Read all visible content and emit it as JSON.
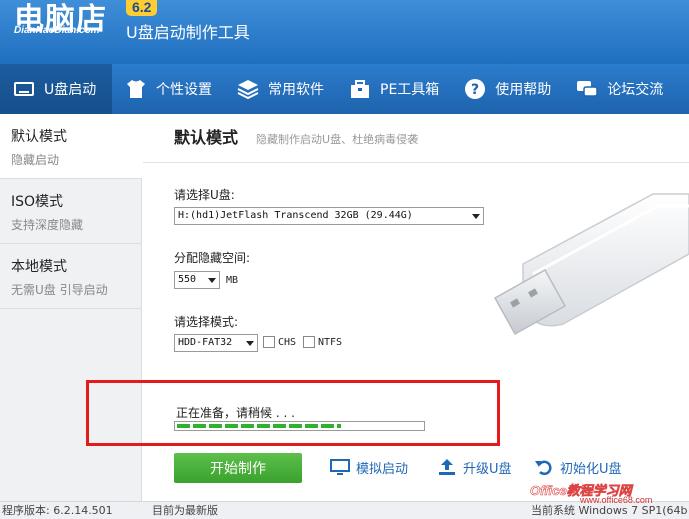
{
  "header": {
    "logo_main": "电脑店",
    "logo_sub": "DianNaoDian.com",
    "version_badge": "6.2",
    "app_title": "U盘启动制作工具"
  },
  "nav": [
    {
      "label": "U盘启动",
      "icon": "usb-drive-icon",
      "active": true
    },
    {
      "label": "个性设置",
      "icon": "shirt-icon",
      "active": false
    },
    {
      "label": "常用软件",
      "icon": "layers-icon",
      "active": false
    },
    {
      "label": "PE工具箱",
      "icon": "toolbox-icon",
      "active": false
    },
    {
      "label": "使用帮助",
      "icon": "help-icon",
      "active": false
    },
    {
      "label": "论坛交流",
      "icon": "chat-icon",
      "active": false
    }
  ],
  "sidebar": [
    {
      "title": "默认模式",
      "desc": "隐藏启动",
      "active": true
    },
    {
      "title": "ISO模式",
      "desc": "支持深度隐藏",
      "active": false
    },
    {
      "title": "本地模式",
      "desc": "无需U盘 引导启动",
      "active": false
    }
  ],
  "main": {
    "title": "默认模式",
    "desc": "隐藏制作启动U盘、杜绝病毒侵袭",
    "usb_label": "请选择U盘:",
    "usb_value": "H:(hd1)JetFlash Transcend 32GB (29.44G)",
    "hidden_label": "分配隐藏空间:",
    "hidden_value": "550",
    "hidden_unit": "MB",
    "mode_label": "请选择模式:",
    "mode_value": "HDD-FAT32",
    "chs_label": "CHS",
    "ntfs_label": "NTFS",
    "status_text": "正在准备，请稍候 . . .",
    "progress_fraction": 0.67
  },
  "actions": {
    "start": "开始制作",
    "simulate": "模拟启动",
    "upgrade": "升级U盘",
    "init": "初始化U盘"
  },
  "statusbar": {
    "version": "程序版本: 6.2.14.501",
    "latest": "目前为最新版",
    "system": "当前系统 Windows 7 SP1(64b"
  },
  "watermark": {
    "text": "Office教程学习网",
    "url": "www.office68.com"
  },
  "colors": {
    "header_blue": "#2c7ccd",
    "nav_active": "#164f8a",
    "start_green": "#3aa22e",
    "progress_green": "#2fb12f",
    "highlight_red": "#e31b1b"
  }
}
